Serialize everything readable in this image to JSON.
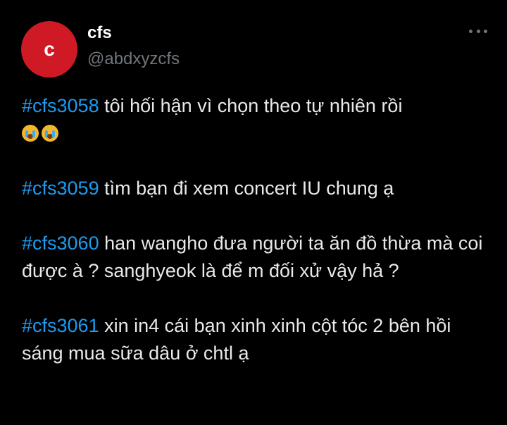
{
  "author": {
    "avatar_letter": "c",
    "display_name": "cfs",
    "handle": "@abdxyzcfs"
  },
  "posts": [
    {
      "hashtag": "#cfs3058",
      "text": " tôi hối hận vì chọn theo tự nhiên rồi",
      "emoji": [
        "loudly-crying-face",
        "loudly-crying-face"
      ]
    },
    {
      "hashtag": "#cfs3059",
      "text": " tìm bạn đi xem concert IU chung ạ"
    },
    {
      "hashtag": "#cfs3060",
      "text": " han wangho đưa người ta ăn đồ thừa mà coi được à ? sanghyeok là để m đối xử vậy hả ?"
    },
    {
      "hashtag": "#cfs3061",
      "text": " xin in4 cái bạn xinh xinh cột tóc 2 bên hồi sáng mua sữa dâu ở chtl ạ"
    }
  ],
  "colors": {
    "background": "#000000",
    "avatar": "#cf1a26",
    "hashtag": "#1d9bf0",
    "secondary_text": "#71767b"
  }
}
